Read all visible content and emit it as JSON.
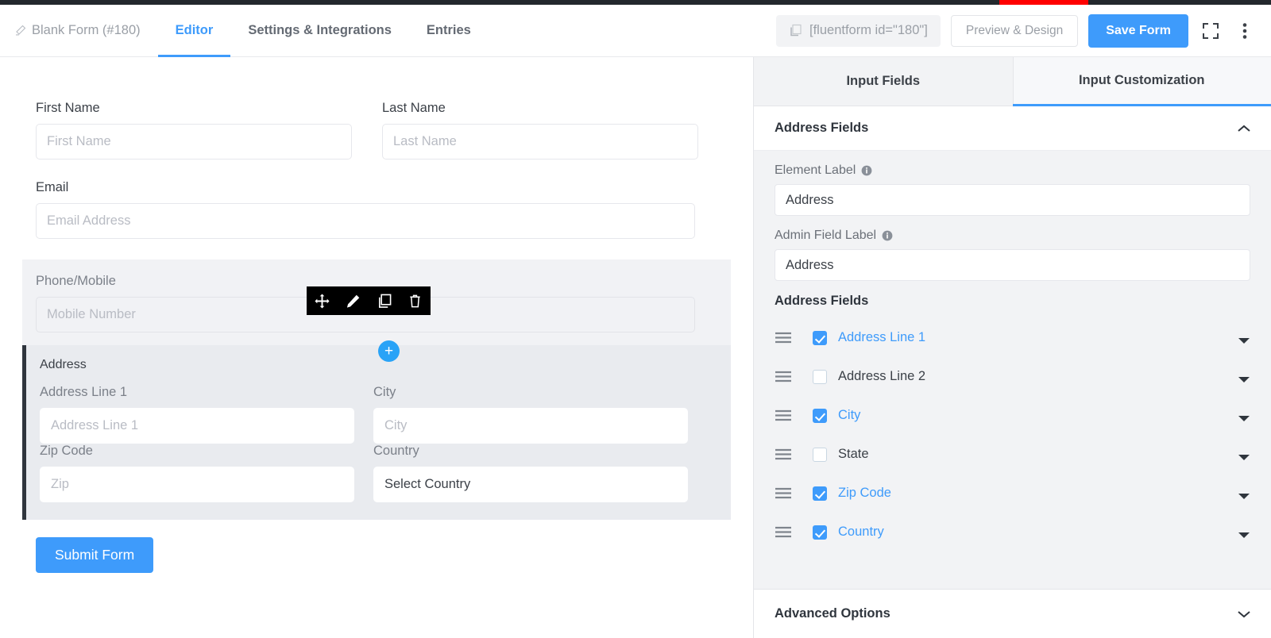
{
  "header": {
    "form_title": "Blank Form (#180)",
    "edit_icon": "pencil-icon",
    "tabs": [
      {
        "label": "Editor",
        "active": true
      },
      {
        "label": "Settings & Integrations",
        "active": false
      },
      {
        "label": "Entries",
        "active": false
      }
    ],
    "shortcode": "[fluentform id=\"180\"]",
    "shortcode_icon": "copy-icon",
    "preview_button": "Preview & Design",
    "save_button": "Save Form",
    "fullscreen_icon": "fullscreen-icon",
    "more_icon": "vertical-dots-icon"
  },
  "colors": {
    "accent_blue": "#3e9bfb",
    "add_button_blue": "#29a3f7",
    "admin_bar": "#23282d",
    "admin_bar_highlight": "#ff0000",
    "selected_border": "#2f353d",
    "panel_bg": "#f2f3f5"
  },
  "form": {
    "fields": [
      {
        "label": "First Name",
        "placeholder": "First Name"
      },
      {
        "label": "Last Name",
        "placeholder": "Last Name"
      },
      {
        "label": "Email",
        "placeholder": "Email Address"
      }
    ],
    "phone_block": {
      "label": "Phone/Mobile",
      "placeholder": "Mobile Number",
      "toolbar": [
        {
          "name": "move-icon",
          "title": "Move"
        },
        {
          "name": "edit-icon",
          "title": "Edit"
        },
        {
          "name": "duplicate-icon",
          "title": "Duplicate"
        },
        {
          "name": "delete-icon",
          "title": "Delete"
        }
      ],
      "add_label": "+"
    },
    "address_block": {
      "title": "Address",
      "line1": {
        "label": "Address Line 1",
        "placeholder": "Address Line 1"
      },
      "city": {
        "label": "City",
        "placeholder": "City"
      },
      "zip": {
        "label": "Zip Code",
        "placeholder": "Zip"
      },
      "country": {
        "label": "Country",
        "value": "Select Country"
      }
    },
    "submit_label": "Submit Form"
  },
  "panel": {
    "tabs": [
      {
        "label": "Input Fields",
        "active": false
      },
      {
        "label": "Input Customization",
        "active": true
      }
    ],
    "section_title": "Address Fields",
    "section_collapse_icon": "chevron-up-icon",
    "element_label": {
      "label": "Element Label",
      "value": "Address",
      "info_icon": "info-icon"
    },
    "admin_field_label": {
      "label": "Admin Field Label",
      "value": "Address",
      "info_icon": "info-icon"
    },
    "address_fields_title": "Address Fields",
    "address_fields": [
      {
        "label": "Address Line 1",
        "checked": true
      },
      {
        "label": "Address Line 2",
        "checked": false
      },
      {
        "label": "City",
        "checked": true
      },
      {
        "label": "State",
        "checked": false
      },
      {
        "label": "Zip Code",
        "checked": true
      },
      {
        "label": "Country",
        "checked": true
      }
    ],
    "advanced_options": "Advanced Options",
    "advanced_options_icon": "chevron-down-icon"
  }
}
